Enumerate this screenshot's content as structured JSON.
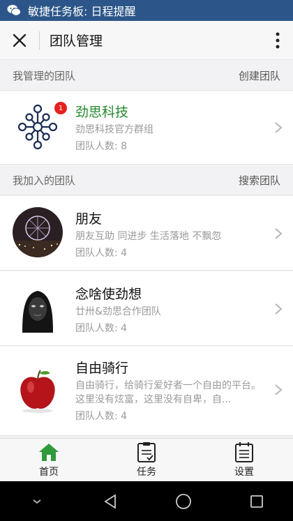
{
  "status_bar": {
    "title": "敏捷任务板: 日程提醒"
  },
  "header": {
    "title": "团队管理"
  },
  "managed_section": {
    "label": "我管理的团队",
    "action": "创建团队"
  },
  "joined_section": {
    "label": "我加入的团队",
    "action": "搜索团队"
  },
  "managed_teams": [
    {
      "name": "劲思科技",
      "desc": "劲思科技官方群组",
      "count": "团队人数: 8",
      "badge": "1"
    }
  ],
  "joined_teams": [
    {
      "name": "朋友",
      "desc": "朋友互助 同进步 生活落地 不飘忽",
      "count": "团队人数: 4"
    },
    {
      "name": "念啥使劲想",
      "desc": "廿卅&劲思合作团队",
      "count": "团队人数: 4"
    },
    {
      "name": "自由骑行",
      "desc": "自由骑行，给骑行爱好者一个自由的平台。这里没有炫富，这里没有自卑，自...",
      "count": "团队人数: 4"
    }
  ],
  "tabs": [
    {
      "label": "首页",
      "icon": "home-icon",
      "color": "#2e9a3a"
    },
    {
      "label": "任务",
      "icon": "clipboard-icon"
    },
    {
      "label": "设置",
      "icon": "calendar-list-icon"
    }
  ],
  "colors": {
    "status_bar": "#2c5689",
    "accent_green": "#268a2e",
    "badge_red": "#e62020"
  }
}
